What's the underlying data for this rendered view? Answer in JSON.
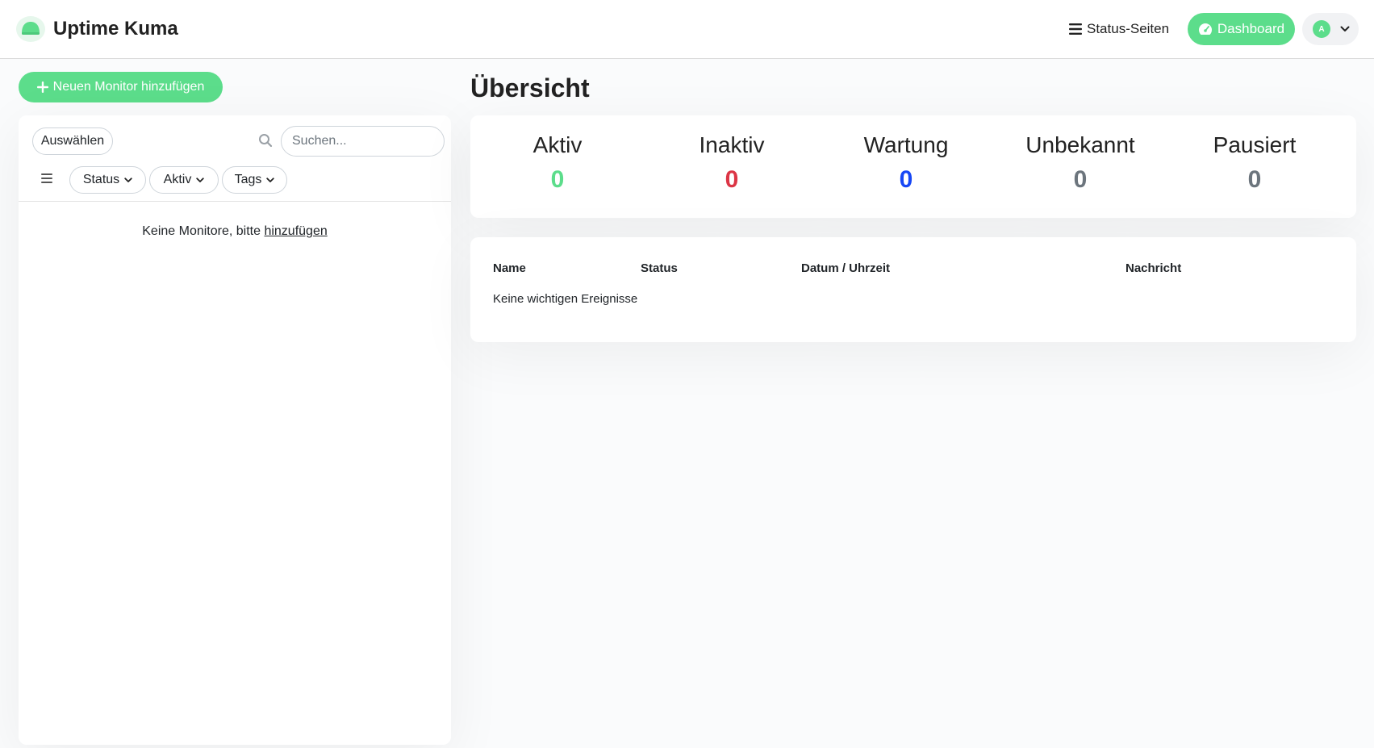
{
  "header": {
    "brand": "Uptime Kuma",
    "logo_icon": "kuma-logo-icon",
    "status_pages_label": "Status-Seiten",
    "dashboard_label": "Dashboard",
    "avatar_initial": "A",
    "accent_color": "#5cdd8b"
  },
  "sidebar": {
    "add_monitor_label": "Neuen Monitor hinzufügen",
    "select_label": "Auswählen",
    "search_placeholder": "Suchen...",
    "search_value": "",
    "filters": [
      {
        "label": "Status"
      },
      {
        "label": "Aktiv"
      },
      {
        "label": "Tags"
      }
    ],
    "empty_text": "Keine Monitore, bitte ",
    "empty_link": "hinzufügen"
  },
  "main": {
    "title": "Übersicht",
    "stats": [
      {
        "label": "Aktiv",
        "value": "0",
        "color": "#5cdd8b"
      },
      {
        "label": "Inaktiv",
        "value": "0",
        "color": "#dc3545"
      },
      {
        "label": "Wartung",
        "value": "0",
        "color": "#1747f5"
      },
      {
        "label": "Unbekannt",
        "value": "0",
        "color": "#6c757d"
      },
      {
        "label": "Pausiert",
        "value": "0",
        "color": "#6c757d"
      }
    ],
    "events": {
      "columns": [
        "Name",
        "Status",
        "Datum / Uhrzeit",
        "Nachricht"
      ],
      "empty_text": "Keine wichtigen Ereignisse"
    }
  }
}
